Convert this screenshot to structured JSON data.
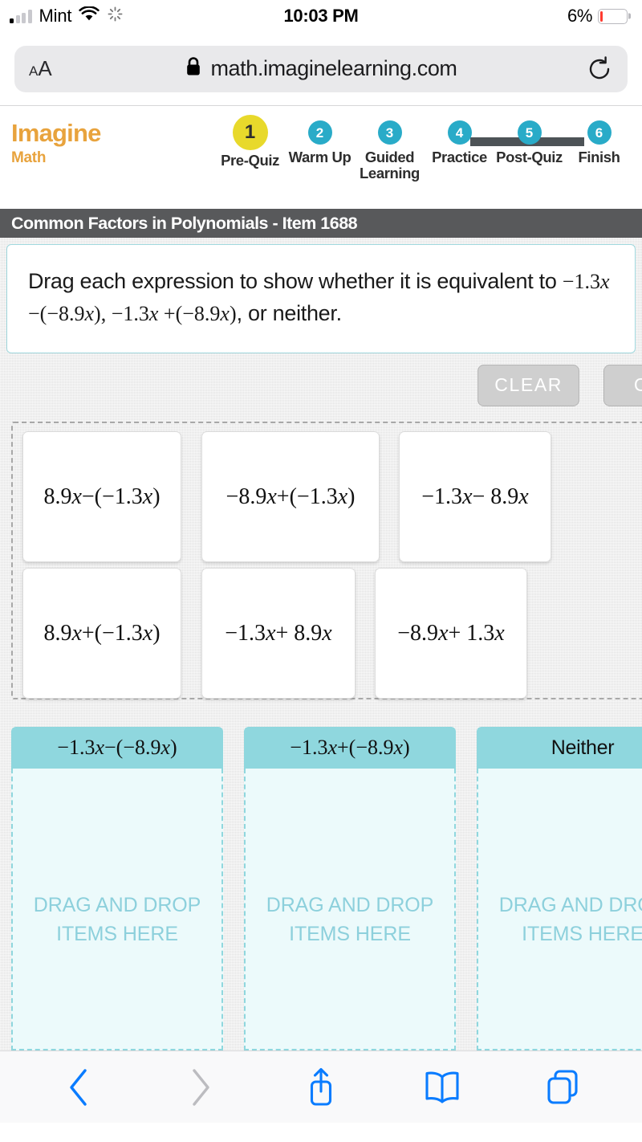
{
  "status_bar": {
    "carrier": "Mint",
    "time": "10:03 PM",
    "battery_percent": "6%",
    "battery_level": 6,
    "signal_bars_filled": 1,
    "icons": [
      "signal-bars-icon",
      "wifi-icon",
      "activity-spinner-icon",
      "battery-icon"
    ]
  },
  "browser": {
    "text_size_label_small": "A",
    "text_size_label_large": "A",
    "lock_icon": "lock-icon",
    "url": "math.imaginelearning.com",
    "reload_icon": "reload-icon",
    "bottom_toolbar": {
      "back": "back-chevron-icon",
      "forward": "forward-chevron-icon",
      "share": "share-icon",
      "bookmarks": "book-icon",
      "tabs": "tabs-icon"
    }
  },
  "app": {
    "brand_main": "Imagine",
    "brand_sub": "Math",
    "title_bar": "Common Factors in Polynomials - Item 1688",
    "accent_yellow": "#e8d92b",
    "accent_teal": "#29abc8",
    "accent_orange": "#e8a33d",
    "title_bar_bg": "#58595b",
    "dropzone_header_bg": "#8fd7de",
    "dropzone_body_bg": "#ecfafb",
    "steps": [
      {
        "number": "1",
        "label": "Pre-Quiz",
        "active": true
      },
      {
        "number": "2",
        "label": "Warm Up",
        "active": false
      },
      {
        "number": "3",
        "label": "Guided Learning",
        "active": false
      },
      {
        "number": "4",
        "label": "Practice",
        "active": false
      },
      {
        "number": "5",
        "label": "Post-Quiz",
        "active": false
      },
      {
        "number": "6",
        "label": "Finish",
        "active": false
      }
    ]
  },
  "question": {
    "line1": "Drag each expression to show whether it is equivalent to",
    "expr_a_pre": "−1.3",
    "expr_a_var": "x",
    "expr_a_mid": " −(−8.9",
    "expr_a_var2": "x",
    "expr_a_post": "), ",
    "expr_b_pre": "−1.3",
    "expr_b_var": "x",
    "expr_b_mid": " +(−8.9",
    "expr_b_var2": "x",
    "expr_b_post": ")",
    "tail": ", or neither."
  },
  "toolbar": {
    "clear_label": "CLEAR",
    "second_button_label": "C"
  },
  "tray": {
    "tiles": [
      {
        "pre": "8.9",
        "v1": "x",
        "mid": " −(−1.3",
        "v2": "x",
        "post": ")"
      },
      {
        "pre": "−8.9",
        "v1": "x",
        "mid": " +(−1.3",
        "v2": "x",
        "post": ")"
      },
      {
        "pre": "−1.3",
        "v1": "x",
        "mid": " − 8.9",
        "v2": "x",
        "post": ""
      },
      {
        "pre": "8.9",
        "v1": "x",
        "mid": " +(−1.3",
        "v2": "x",
        "post": ")"
      },
      {
        "pre": "−1.3",
        "v1": "x",
        "mid": " + 8.9",
        "v2": "x",
        "post": ""
      },
      {
        "pre": "−8.9",
        "v1": "x",
        "mid": " + 1.3",
        "v2": "x",
        "post": ""
      }
    ]
  },
  "dropzones": [
    {
      "header_pre": "−1.3",
      "header_v1": "x",
      "header_mid": " −(−8.9",
      "header_v2": "x",
      "header_post": ")",
      "header_plain": "",
      "placeholder": "DRAG AND DROP ITEMS HERE"
    },
    {
      "header_pre": "−1.3",
      "header_v1": "x",
      "header_mid": " +(−8.9",
      "header_v2": "x",
      "header_post": ")",
      "header_plain": "",
      "placeholder": "DRAG AND DROP ITEMS HERE"
    },
    {
      "header_pre": "",
      "header_v1": "",
      "header_mid": "",
      "header_v2": "",
      "header_post": "",
      "header_plain": "Neither",
      "placeholder": "DRAG AND DROP ITEMS HERE"
    }
  ]
}
